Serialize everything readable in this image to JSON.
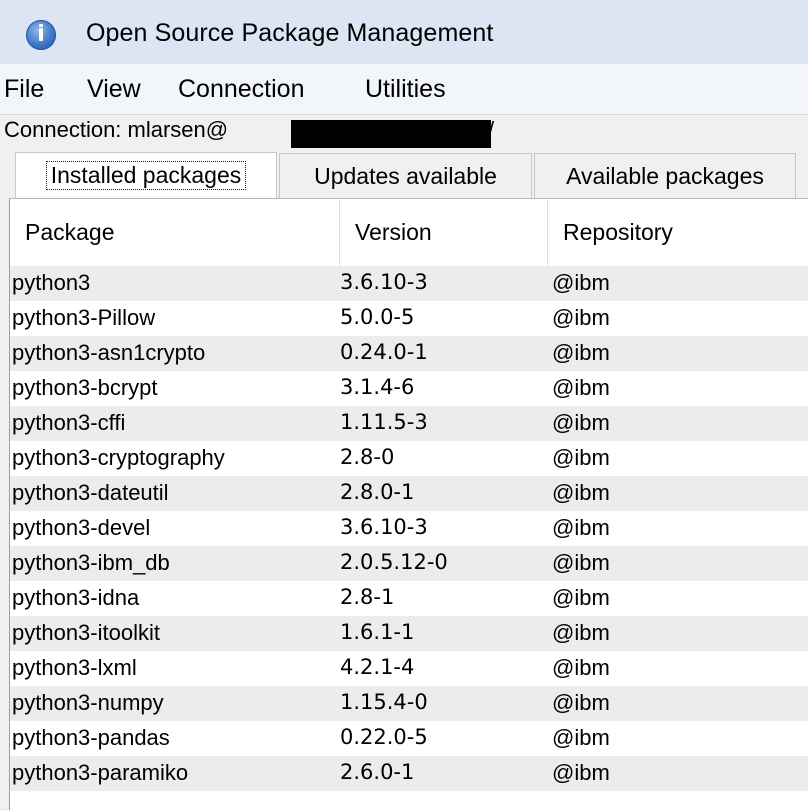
{
  "window": {
    "title": "Open Source Package Management",
    "icon": "info-icon"
  },
  "menu": [
    "File",
    "View",
    "Connection",
    "Utilities"
  ],
  "connection": {
    "label": "Connection: mlarsen@",
    "suffix": "/"
  },
  "tabs": [
    {
      "label": "Installed packages",
      "active": true
    },
    {
      "label": "Updates available",
      "active": false
    },
    {
      "label": "Available packages",
      "active": false
    }
  ],
  "table": {
    "columns": [
      "Package",
      "Version",
      "Repository"
    ],
    "rows": [
      [
        "python3",
        "3.6.10-3",
        "@ibm"
      ],
      [
        "python3-Pillow",
        "5.0.0-5",
        "@ibm"
      ],
      [
        "python3-asn1crypto",
        "0.24.0-1",
        "@ibm"
      ],
      [
        "python3-bcrypt",
        "3.1.4-6",
        "@ibm"
      ],
      [
        "python3-cffi",
        "1.11.5-3",
        "@ibm"
      ],
      [
        "python3-cryptography",
        "2.8-0",
        "@ibm"
      ],
      [
        "python3-dateutil",
        "2.8.0-1",
        "@ibm"
      ],
      [
        "python3-devel",
        "3.6.10-3",
        "@ibm"
      ],
      [
        "python3-ibm_db",
        "2.0.5.12-0",
        "@ibm"
      ],
      [
        "python3-idna",
        "2.8-1",
        "@ibm"
      ],
      [
        "python3-itoolkit",
        "1.6.1-1",
        "@ibm"
      ],
      [
        "python3-lxml",
        "4.2.1-4",
        "@ibm"
      ],
      [
        "python3-numpy",
        "1.15.4-0",
        "@ibm"
      ],
      [
        "python3-pandas",
        "0.22.0-5",
        "@ibm"
      ],
      [
        "python3-paramiko",
        "2.6.0-1",
        "@ibm"
      ]
    ]
  }
}
